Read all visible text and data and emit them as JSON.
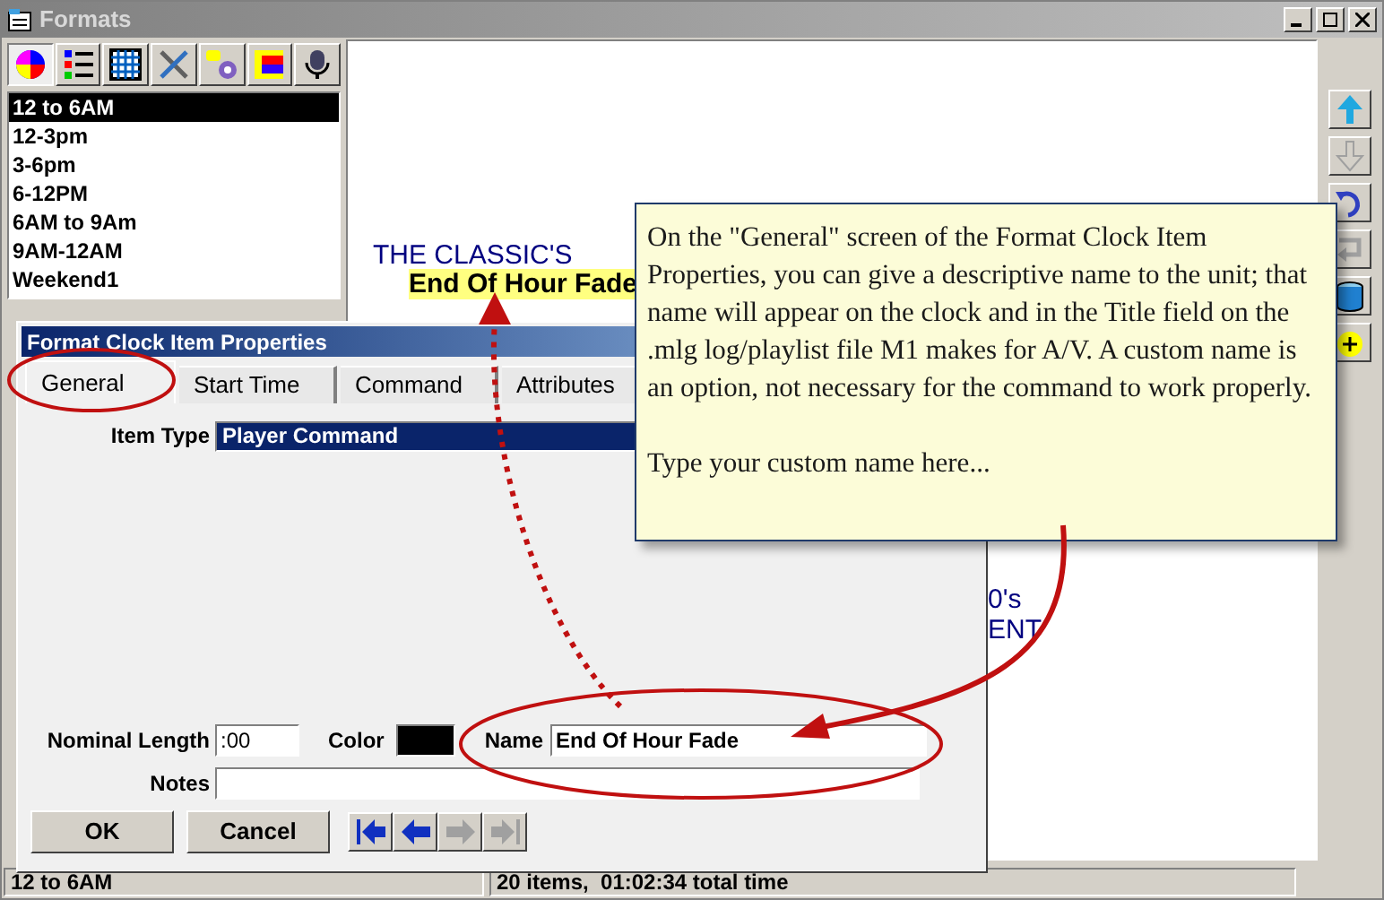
{
  "window": {
    "title": "Formats"
  },
  "tools": [
    {
      "kind": "pie",
      "selected": true
    },
    {
      "kind": "list",
      "selected": false
    },
    {
      "kind": "grid",
      "selected": false
    },
    {
      "kind": "tools",
      "selected": false
    },
    {
      "kind": "tag",
      "selected": false
    },
    {
      "kind": "bars",
      "selected": false
    },
    {
      "kind": "mic",
      "selected": false
    }
  ],
  "formats_list": {
    "items": [
      {
        "label": "12 to 6AM",
        "selected": true
      },
      {
        "label": "12-3pm",
        "selected": false
      },
      {
        "label": "3-6pm",
        "selected": false
      },
      {
        "label": "6-12PM",
        "selected": false
      },
      {
        "label": "6AM to 9Am",
        "selected": false
      },
      {
        "label": "9AM-12AM",
        "selected": false
      },
      {
        "label": "Weekend1",
        "selected": false
      }
    ]
  },
  "canvas": {
    "texts": [
      {
        "text": "THE CLASSIC'S",
        "kind": "plain"
      },
      {
        "text": "End Of Hour Fade",
        "kind": "highlight"
      },
      {
        "text": "0's",
        "kind": "plain"
      },
      {
        "text": "ENT",
        "kind": "plain"
      }
    ]
  },
  "side_tools": [
    {
      "kind": "up",
      "disabled": false
    },
    {
      "kind": "down",
      "disabled": true
    },
    {
      "kind": "undo",
      "disabled": false
    },
    {
      "kind": "redo",
      "disabled": true
    },
    {
      "kind": "bin",
      "disabled": false
    },
    {
      "kind": "add",
      "disabled": false
    }
  ],
  "dialog": {
    "title": "Format Clock Item Properties",
    "tabs": [
      {
        "label": "General",
        "selected": true
      },
      {
        "label": "Start Time",
        "selected": false
      },
      {
        "label": "Command",
        "selected": false
      },
      {
        "label": "Attributes",
        "selected": false
      }
    ],
    "item_type": {
      "label": "Item Type",
      "value": "Player Command"
    },
    "nominal_length": {
      "label": "Nominal Length",
      "value": ":00"
    },
    "color": {
      "label": "Color",
      "color": "#000000"
    },
    "name": {
      "label": "Name",
      "value": "End Of Hour Fade"
    },
    "notes": {
      "label": "Notes"
    },
    "buttons": [
      "OK",
      "Cancel"
    ],
    "nav": [
      {
        "kind": "first",
        "disabled": false
      },
      {
        "kind": "prev",
        "disabled": false
      },
      {
        "kind": "next",
        "disabled": true
      },
      {
        "kind": "last",
        "disabled": true
      }
    ]
  },
  "callout": {
    "paragraphs": [
      "On the \"General\" screen of the Format Clock Item Properties, you can give a descriptive name to the unit; that name will appear on the clock and in the Title field on the .mlg log/playlist file M1 makes for A/V.  A custom name is an option, not necessary for the command to work properly.",
      "Type your custom name here..."
    ]
  },
  "status_bar": [
    "12 to 6AM",
    "20 items,  01:02:34 total time"
  ]
}
